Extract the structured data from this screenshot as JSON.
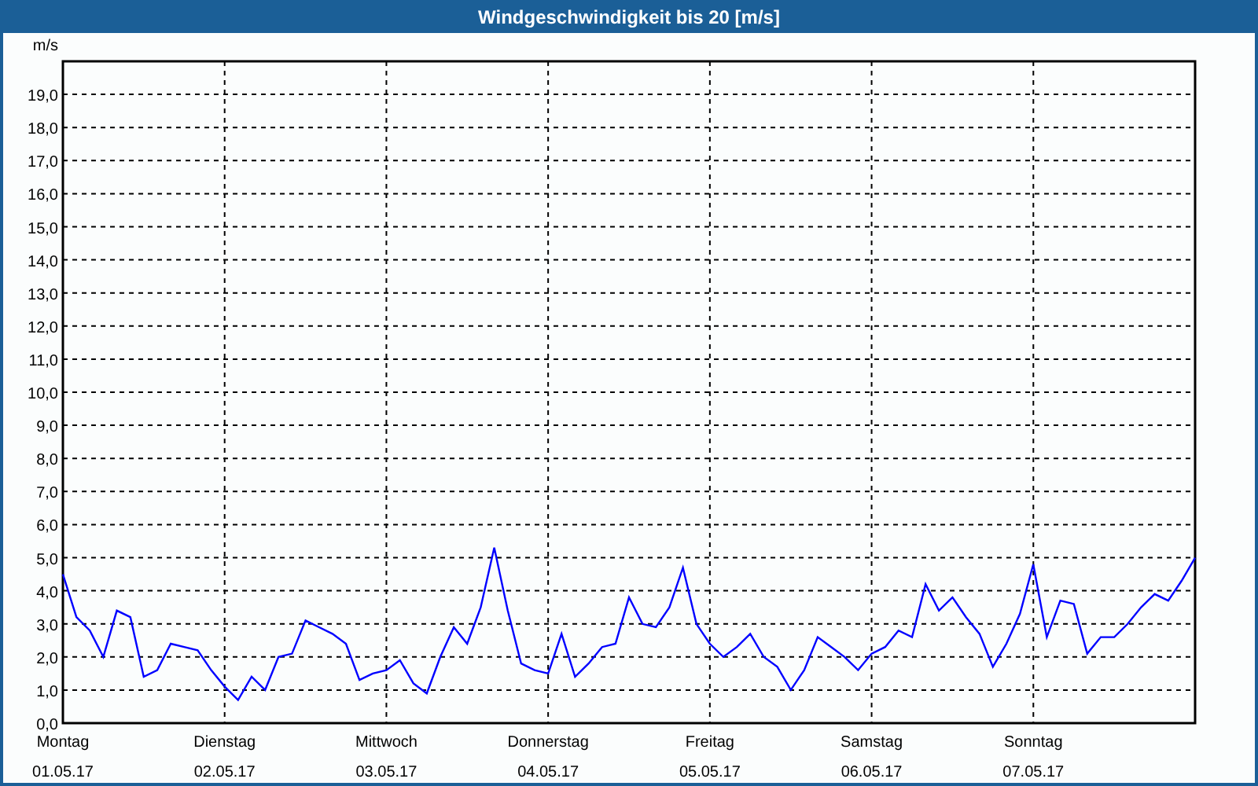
{
  "window": {
    "title": "Windgeschwindigkeit bis 20 [m/s]"
  },
  "chart": {
    "chart_data": {
      "type": "line",
      "ylabel": "m/s",
      "categories": [
        "Montag",
        null,
        null,
        null,
        null,
        null,
        null,
        null,
        null,
        null,
        null,
        null,
        "Dienstag",
        null,
        null,
        null,
        null,
        null,
        null,
        null,
        null,
        null,
        null,
        null,
        "Mittwoch",
        null,
        null,
        null,
        null,
        null,
        null,
        null,
        null,
        null,
        null,
        null,
        "Donnerstag",
        null,
        null,
        null,
        null,
        null,
        null,
        null,
        null,
        null,
        null,
        null,
        "Freitag",
        null,
        null,
        null,
        null,
        null,
        null,
        null,
        null,
        null,
        null,
        null,
        "Samstag",
        null,
        null,
        null,
        null,
        null,
        null,
        null,
        null,
        null,
        null,
        null,
        "Sonntag",
        null,
        null,
        null,
        null,
        null,
        null,
        null,
        null,
        null,
        null,
        null,
        null
      ],
      "series": [
        {
          "color": "#0000ff",
          "values": [
            4.5,
            3.2,
            2.8,
            2.0,
            3.4,
            3.2,
            1.4,
            1.6,
            2.4,
            2.3,
            2.2,
            1.6,
            1.1,
            0.7,
            1.4,
            1.0,
            2.0,
            2.1,
            3.1,
            2.9,
            2.7,
            2.4,
            1.3,
            1.5,
            1.6,
            1.9,
            1.2,
            0.9,
            2.0,
            2.9,
            2.4,
            3.5,
            5.3,
            3.4,
            1.8,
            1.6,
            1.5,
            2.7,
            1.4,
            1.8,
            2.3,
            2.4,
            3.8,
            3.0,
            2.9,
            3.5,
            4.7,
            3.0,
            2.4,
            2.0,
            2.3,
            2.7,
            2.0,
            1.7,
            1.0,
            1.6,
            2.6,
            2.3,
            2.0,
            1.6,
            2.1,
            2.3,
            2.8,
            2.6,
            4.2,
            3.4,
            3.8,
            3.2,
            2.7,
            1.7,
            2.4,
            3.3,
            4.8,
            2.6,
            3.7,
            3.6,
            2.1,
            2.6,
            2.6,
            3.0,
            3.5,
            3.9,
            3.7,
            4.3,
            5.0
          ]
        }
      ],
      "ylim": [
        0,
        20
      ],
      "grid": true,
      "yticks": [
        {
          "value": 0,
          "label": "0,0"
        },
        {
          "value": 1,
          "label": "1,0"
        },
        {
          "value": 2,
          "label": "2,0"
        },
        {
          "value": 3,
          "label": "3,0"
        },
        {
          "value": 4,
          "label": "4,0"
        },
        {
          "value": 5,
          "label": "5,0"
        },
        {
          "value": 6,
          "label": "6,0"
        },
        {
          "value": 7,
          "label": "7,0"
        },
        {
          "value": 8,
          "label": "8,0"
        },
        {
          "value": 9,
          "label": "9,0"
        },
        {
          "value": 10,
          "label": "10,0"
        },
        {
          "value": 11,
          "label": "11,0"
        },
        {
          "value": 12,
          "label": "12,0"
        },
        {
          "value": 13,
          "label": "13,0"
        },
        {
          "value": 14,
          "label": "14,0"
        },
        {
          "value": 15,
          "label": "15,0"
        },
        {
          "value": 16,
          "label": "16,0"
        },
        {
          "value": 17,
          "label": "17,0"
        },
        {
          "value": 18,
          "label": "18,0"
        },
        {
          "value": 19,
          "label": "19,0"
        }
      ]
    },
    "dates": [
      "01.05.17",
      "02.05.17",
      "03.05.17",
      "04.05.17",
      "05.05.17",
      "06.05.17",
      "07.05.17"
    ]
  }
}
